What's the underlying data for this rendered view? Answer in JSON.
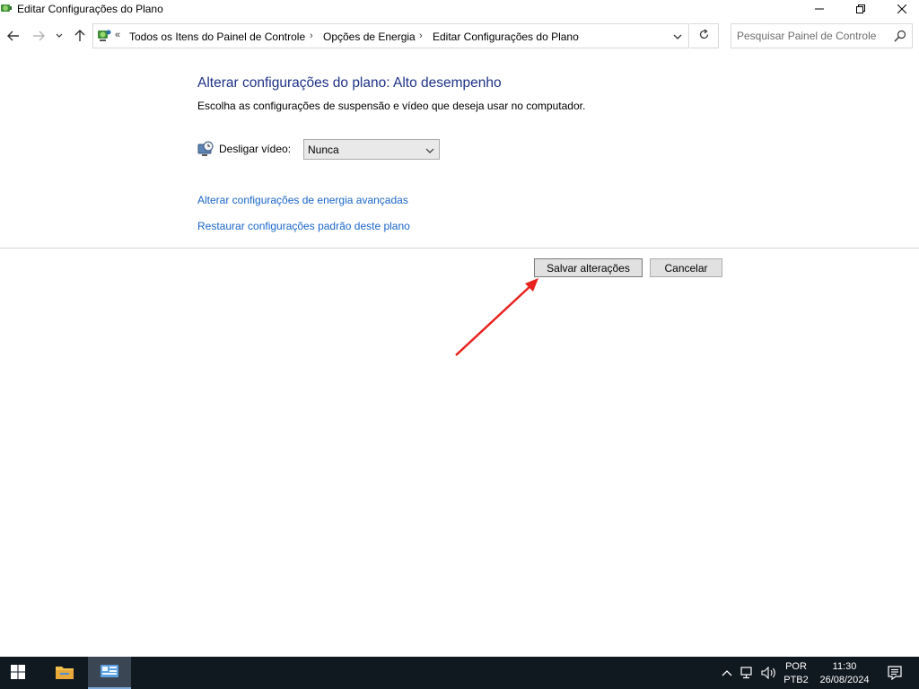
{
  "window": {
    "title": "Editar Configurações do Plano"
  },
  "navigation": {
    "breadcrumbs": [
      "Todos os Itens do Painel de Controle",
      "Opções de Energia",
      "Editar Configurações do Plano"
    ],
    "overflow_indicator": "«",
    "separator": "›",
    "search_placeholder": "Pesquisar Painel de Controle"
  },
  "content": {
    "heading": "Alterar configurações do plano: Alto desempenho",
    "subheading": "Escolha as configurações de suspensão e vídeo que deseja usar no computador.",
    "settings": [
      {
        "label": "Desligar vídeo:",
        "value": "Nunca",
        "icon": "monitor-clock-icon"
      }
    ],
    "links": {
      "advanced": "Alterar configurações de energia avançadas",
      "restore": "Restaurar configurações padrão deste plano"
    },
    "buttons": {
      "save": "Salvar alterações",
      "cancel": "Cancelar"
    }
  },
  "taskbar": {
    "pinned": [
      "windows-start-icon",
      "file-explorer-icon",
      "control-panel-icon"
    ],
    "language": "POR",
    "keyboard": "PTB2",
    "time": "11:30",
    "date": "26/08/2024"
  },
  "colors": {
    "heading": "#1e3287",
    "link": "#1a66c8",
    "annotation_arrow": "#e8231f",
    "taskbar": "#101820"
  }
}
